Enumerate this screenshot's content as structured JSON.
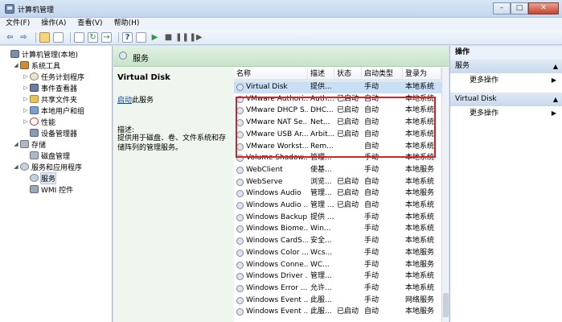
{
  "window": {
    "title": "计算机管理"
  },
  "window_buttons": {
    "minimize": "–",
    "maximize": "□",
    "close": "✕"
  },
  "menu": [
    "文件(F)",
    "操作(A)",
    "查看(V)",
    "帮助(H)"
  ],
  "toolbar_icons": [
    "back-arrow-icon",
    "forward-arrow-icon",
    "up-folder-icon",
    "show-hide-tree-icon",
    "properties-icon",
    "refresh-icon",
    "export-icon",
    "help-icon",
    "console-icon",
    "start-service-icon",
    "stop-service-icon",
    "pause-service-icon",
    "restart-service-icon"
  ],
  "tree": [
    {
      "label": "计算机管理(本地)",
      "level": 0,
      "expander": "",
      "icon": "pc"
    },
    {
      "label": "系统工具",
      "level": 1,
      "expander": "◢",
      "icon": "tool"
    },
    {
      "label": "任务计划程序",
      "level": 2,
      "expander": "▷",
      "icon": "clock"
    },
    {
      "label": "事件查看器",
      "level": 2,
      "expander": "▷",
      "icon": "log"
    },
    {
      "label": "共享文件夹",
      "level": 2,
      "expander": "▷",
      "icon": "folder"
    },
    {
      "label": "本地用户和组",
      "level": 2,
      "expander": "▷",
      "icon": "users"
    },
    {
      "label": "性能",
      "level": 2,
      "expander": "▷",
      "icon": "perf"
    },
    {
      "label": "设备管理器",
      "level": 2,
      "expander": "",
      "icon": "dev"
    },
    {
      "label": "存储",
      "level": 1,
      "expander": "◢",
      "icon": "disk"
    },
    {
      "label": "磁盘管理",
      "level": 2,
      "expander": "",
      "icon": "disk"
    },
    {
      "label": "服务和应用程序",
      "level": 1,
      "expander": "◢",
      "icon": "svc"
    },
    {
      "label": "服务",
      "level": 2,
      "expander": "",
      "icon": "svc",
      "selected": true
    },
    {
      "label": "WMI 控件",
      "level": 2,
      "expander": "",
      "icon": "wmi"
    }
  ],
  "center": {
    "header_title": "服务",
    "detail": {
      "service_name": "Virtual Disk",
      "start_link": "启动",
      "start_suffix": "此服务",
      "desc_label": "描述:",
      "desc_text": "提供用于磁盘、卷、文件系统和存储阵列的管理服务。"
    },
    "columns": [
      "名称",
      "描述",
      "状态",
      "启动类型",
      "登录为"
    ],
    "rows": [
      {
        "name": "Virtual Disk",
        "desc": "提供...",
        "status": "",
        "startup": "手动",
        "logon": "本地系统",
        "selected": true
      },
      {
        "name": "VMware Authori...",
        "desc": "Auth...",
        "status": "已启动",
        "startup": "自动",
        "logon": "本地系统"
      },
      {
        "name": "VMware DHCP S...",
        "desc": "DHC...",
        "status": "已启动",
        "startup": "自动",
        "logon": "本地系统"
      },
      {
        "name": "VMware NAT Se...",
        "desc": "Net...",
        "status": "已启动",
        "startup": "自动",
        "logon": "本地系统"
      },
      {
        "name": "VMware USB Ar...",
        "desc": "Arbit...",
        "status": "已启动",
        "startup": "自动",
        "logon": "本地系统"
      },
      {
        "name": "VMware Workst...",
        "desc": "Rem...",
        "status": "",
        "startup": "自动",
        "logon": "本地系统"
      },
      {
        "name": "Volume Shadow...",
        "desc": "管理...",
        "status": "",
        "startup": "手动",
        "logon": "本地系统"
      },
      {
        "name": "WebClient",
        "desc": "使基...",
        "status": "",
        "startup": "手动",
        "logon": "本地服务"
      },
      {
        "name": "WebServe",
        "desc": "浏览...",
        "status": "已启动",
        "startup": "自动",
        "logon": "本地系统"
      },
      {
        "name": "Windows Audio",
        "desc": "管理...",
        "status": "已启动",
        "startup": "自动",
        "logon": "本地服务"
      },
      {
        "name": "Windows Audio ...",
        "desc": "管理 ...",
        "status": "已启动",
        "startup": "自动",
        "logon": "本地系统"
      },
      {
        "name": "Windows Backup",
        "desc": "提供 ...",
        "status": "",
        "startup": "手动",
        "logon": "本地系统"
      },
      {
        "name": "Windows Biome...",
        "desc": "Win...",
        "status": "",
        "startup": "手动",
        "logon": "本地系统"
      },
      {
        "name": "Windows CardS...",
        "desc": "安全...",
        "status": "",
        "startup": "手动",
        "logon": "本地系统"
      },
      {
        "name": "Windows Color ...",
        "desc": "Wcs...",
        "status": "",
        "startup": "手动",
        "logon": "本地服务"
      },
      {
        "name": "Windows Conne...",
        "desc": "WC...",
        "status": "",
        "startup": "手动",
        "logon": "本地服务"
      },
      {
        "name": "Windows Driver ...",
        "desc": "管理...",
        "status": "",
        "startup": "手动",
        "logon": "本地系统"
      },
      {
        "name": "Windows Error ...",
        "desc": "允许...",
        "status": "",
        "startup": "手动",
        "logon": "本地系统"
      },
      {
        "name": "Windows Event ...",
        "desc": "此服...",
        "status": "",
        "startup": "手动",
        "logon": "网络服务"
      },
      {
        "name": "Windows Event ...",
        "desc": "此服...",
        "status": "已启动",
        "startup": "自动",
        "logon": "本地服务"
      }
    ]
  },
  "actions": {
    "title": "操作",
    "sections": [
      {
        "title": "服务",
        "items": [
          "更多操作"
        ]
      },
      {
        "title": "Virtual Disk",
        "items": [
          "更多操作"
        ]
      }
    ]
  },
  "colors": {
    "highlight_border": "#e02020",
    "header_green": "#c6e4c8",
    "selection": "#c9dff6"
  }
}
